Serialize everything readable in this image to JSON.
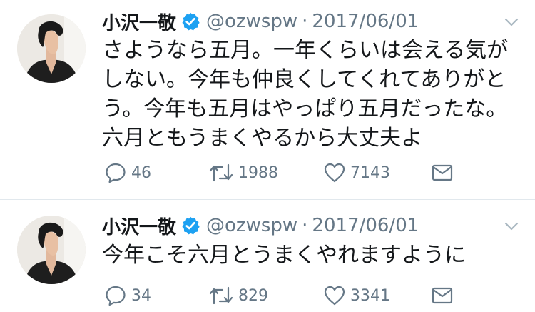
{
  "tweets": [
    {
      "author": {
        "display_name": "小沢一敬",
        "handle": "@ozwspw",
        "verified": true
      },
      "separator": "·",
      "date": "2017/06/01",
      "text_lines": [
        "さようなら五月。一年くらいは会える気が",
        "しない。今年も仲良くしてくれてありがと",
        "う。今年も五月はやっぱり五月だったな。",
        "六月ともうまくやるから大丈夫よ"
      ],
      "actions": {
        "replies": "46",
        "retweets": "1988",
        "likes": "7143"
      }
    },
    {
      "author": {
        "display_name": "小沢一敬",
        "handle": "@ozwspw",
        "verified": true
      },
      "separator": "·",
      "date": "2017/06/01",
      "text_lines": [
        "今年こそ六月とうまくやれますように"
      ],
      "actions": {
        "replies": "34",
        "retweets": "829",
        "likes": "3341"
      }
    }
  ],
  "icons": {
    "verified": "verified-badge-icon",
    "caret": "chevron-down-icon",
    "reply": "reply-icon",
    "retweet": "retweet-icon",
    "like": "heart-icon",
    "dm": "envelope-icon"
  },
  "colors": {
    "verified_blue": "#1da1f2",
    "secondary_text": "#657786",
    "primary_text": "#14171a",
    "separator": "#e1e8ed"
  }
}
